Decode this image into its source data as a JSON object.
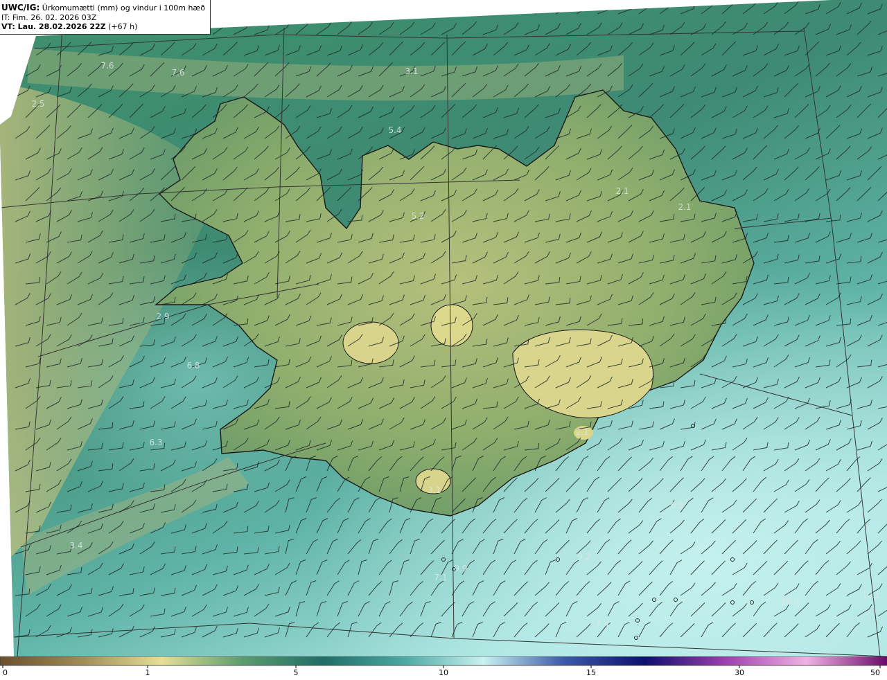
{
  "header": {
    "product": "UWC/IG:",
    "title": "Úrkomumætti (mm) og vindur i 100m hæð",
    "init_time": "IT: Fim. 26. 02. 2026 03Z",
    "valid_prefix": "VT: Lau. 28.02.2026 22Z",
    "valid_offset": "(+67 h)"
  },
  "colors": {
    "sea_low": "#2f7a6b",
    "land_high": "#d6d48c",
    "sea_high": "#b8ece8",
    "coast": "#1a1a1a",
    "grid": "#333333"
  },
  "map_labels": [
    {
      "text": "7.6"
    },
    {
      "text": "7.6"
    },
    {
      "text": "3.1"
    },
    {
      "text": "2.5"
    },
    {
      "text": "5.4"
    },
    {
      "text": "5.2"
    },
    {
      "text": "2.1"
    },
    {
      "text": "2.1"
    },
    {
      "text": "2.9"
    },
    {
      "text": "6.8"
    },
    {
      "text": "6.3"
    },
    {
      "text": "2.1"
    },
    {
      "text": "3.1"
    },
    {
      "text": "6.8"
    },
    {
      "text": "3.4"
    },
    {
      "text": "9.9"
    },
    {
      "text": "7.1"
    },
    {
      "text": "9.2"
    },
    {
      "text": "10.0"
    },
    {
      "text": "7.4"
    },
    {
      "text": "10.1"
    }
  ],
  "colorbar": {
    "ticks": [
      "0",
      "1",
      "5",
      "10",
      "15",
      "30",
      "50"
    ],
    "stops": [
      "#6b4f2e",
      "#a08a55",
      "#e6df96",
      "#5b9d6e",
      "#1f6d66",
      "#4aa8a2",
      "#c9f2f0",
      "#3b5aa8",
      "#0c0f6e",
      "#9e3fae",
      "#f0b2e4",
      "#6a0a6a"
    ]
  }
}
